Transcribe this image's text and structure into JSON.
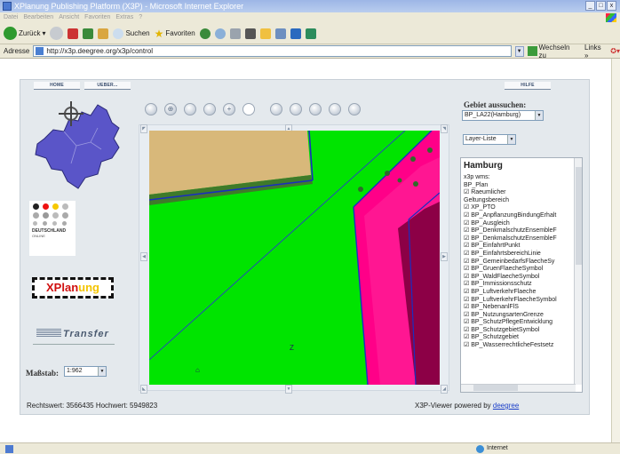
{
  "window": {
    "title": "XPlanung Publishing Platform (X3P) - Microsoft Internet Explorer",
    "min": "_",
    "max": "□",
    "close": "x"
  },
  "menu": [
    "Datei",
    "Bearbeiten",
    "Ansicht",
    "Favoriten",
    "Extras",
    "?"
  ],
  "toolbar": {
    "back": "Zurück",
    "search": "Suchen",
    "favorites": "Favoriten"
  },
  "address": {
    "label": "Adresse",
    "url": "http://x3p.deegree.org/x3p/control",
    "go": "Wechseln zu",
    "links": "Links"
  },
  "nav": {
    "home": "HOME",
    "ueber": "UEBER...",
    "hilfe": "HILFE"
  },
  "tools": [
    "",
    "⊕",
    "",
    "",
    "+",
    "",
    "",
    "",
    "",
    "",
    ""
  ],
  "region": {
    "label": "Gebiet aussuchen:",
    "selected": "BP_LA22(Hamburg)"
  },
  "layer_select": "Layer-Liste",
  "layers": {
    "heading": "Hamburg",
    "lines": [
      "x3p wms:",
      " BP_Plan",
      "☑ Raeumlicher",
      "  Geltungsbereich",
      "☑ XP_PTO",
      "☑ BP_AnpflanzungBindungErhalt",
      "☑ BP_Ausgleich",
      "☑ BP_DenkmalschutzEnsembleF",
      "☑ BP_DenkmalschutzEnsembleF",
      "☑ BP_EinfahrtPunkt",
      "☑ BP_EinfahrtsbereichLinie",
      "☑ BP_GemeinbedarfsFlaecheSy",
      "☑ BP_GruenFlaecheSymbol",
      "☑ BP_WaldFlaecheSymbol",
      "☑ BP_Immissionsschutz",
      "☑ BP_LuftverkehrFlaeche",
      "☑ BP_LuftverkehrFlaecheSymbol",
      "☑ BP_NebenanlFlS",
      "☑ BP_NutzungsartenGrenze",
      "☑ BP_SchutzPflegeEntwicklung",
      "☑ BP_SchutzgebietSymbol",
      "☑ BP_Schutzgebiet",
      "☑ BP_WasserrechtlicheFestsetz"
    ]
  },
  "scale": {
    "label": "Maßstab:",
    "value": "1:962"
  },
  "map_label": "Z",
  "map_label2": "⌂",
  "logos": {
    "deutschland": "DEUTSCHLAND",
    "online": "ONLINE",
    "xplanung_a": "XPlan",
    "xplanung_b": "ung",
    "transfer": "Transfer"
  },
  "footer": {
    "coords": "Rechtswert: 3566435  Hochwert: 5949823",
    "powered": "X3P-Viewer powered by ",
    "powered_link": "deegree"
  },
  "status": {
    "zone": "Internet"
  },
  "colors": {
    "map_green": "#00e400",
    "pink": "#ff0088",
    "tan": "#d8b87a",
    "hamburg_blue": "#5a55c8"
  }
}
